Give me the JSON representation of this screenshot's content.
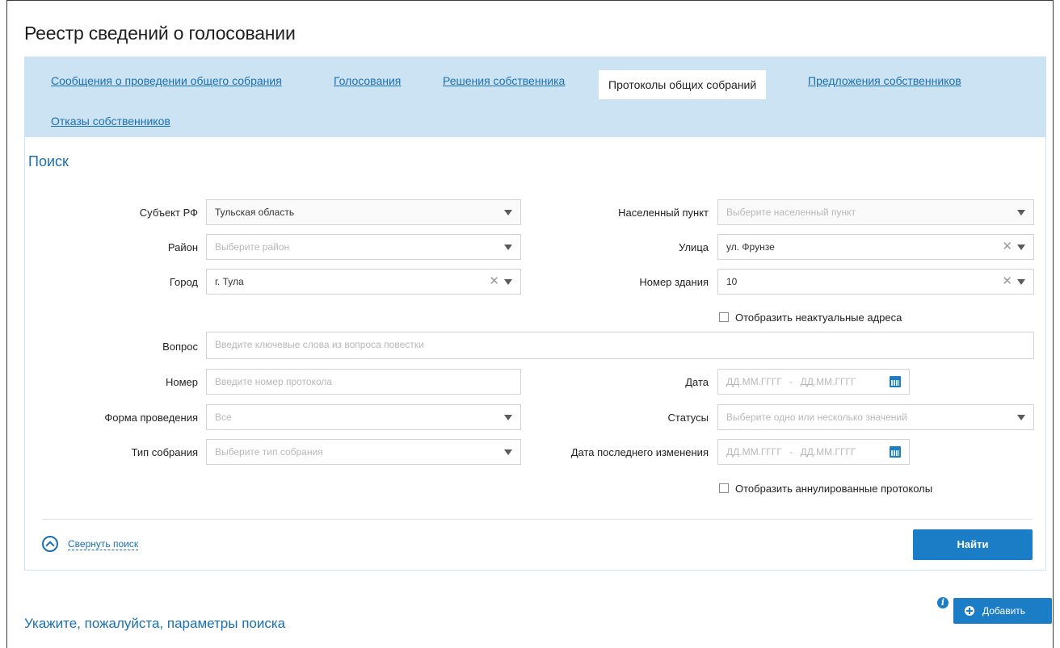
{
  "page": {
    "title": "Реестр сведений о голосовании"
  },
  "tabs": [
    {
      "label": "Сообщения о проведении общего собрания",
      "active": false
    },
    {
      "label": "Голосования",
      "active": false
    },
    {
      "label": "Решения собственника",
      "active": false
    },
    {
      "label": "Протоколы общих собраний",
      "active": true
    },
    {
      "label": "Предложения собственников",
      "active": false
    },
    {
      "label": "Отказы собственников",
      "active": false
    }
  ],
  "search": {
    "title": "Поиск",
    "subject": {
      "label": "Субъект РФ",
      "value": "Тульская область"
    },
    "settlement": {
      "label": "Населенный пункт",
      "placeholder": "Выберите населенный пункт"
    },
    "district": {
      "label": "Район",
      "placeholder": "Выберите район"
    },
    "street": {
      "label": "Улица",
      "value": "ул. Фрунзе"
    },
    "city": {
      "label": "Город",
      "value": "г. Тула"
    },
    "building": {
      "label": "Номер здания",
      "value": "10"
    },
    "show_inactive": {
      "label": "Отобразить неактуальные адреса",
      "checked": false
    },
    "question": {
      "label": "Вопрос",
      "placeholder": "Введите ключевые слова из вопроса повестки"
    },
    "number": {
      "label": "Номер",
      "placeholder": "Введите номер протокола"
    },
    "date": {
      "label": "Дата",
      "from_placeholder": "ДД.ММ.ГГГГ",
      "separator": "-",
      "to_placeholder": "ДД.ММ.ГГГГ"
    },
    "form": {
      "label": "Форма проведения",
      "placeholder": "Все"
    },
    "statuses": {
      "label": "Статусы",
      "placeholder": "Выберите одно или несколько значений"
    },
    "meeting_type": {
      "label": "Тип собрания",
      "placeholder": "Выберите тип собрания"
    },
    "last_change": {
      "label": "Дата последнего изменения",
      "from_placeholder": "ДД.ММ.ГГГГ",
      "separator": "-",
      "to_placeholder": "ДД.ММ.ГГГГ"
    },
    "show_annulled": {
      "label": "Отобразить аннулированные протоколы",
      "checked": false
    },
    "collapse_label": "Свернуть поиск",
    "find_label": "Найти"
  },
  "results": {
    "add_label": "Добавить",
    "info_glyph": "i",
    "hint": "Укажите, пожалуйста, параметры поиска"
  },
  "colors": {
    "accent": "#1a7dc6",
    "tabs_bg": "#cbe3f3",
    "link": "#1a6fb3"
  }
}
